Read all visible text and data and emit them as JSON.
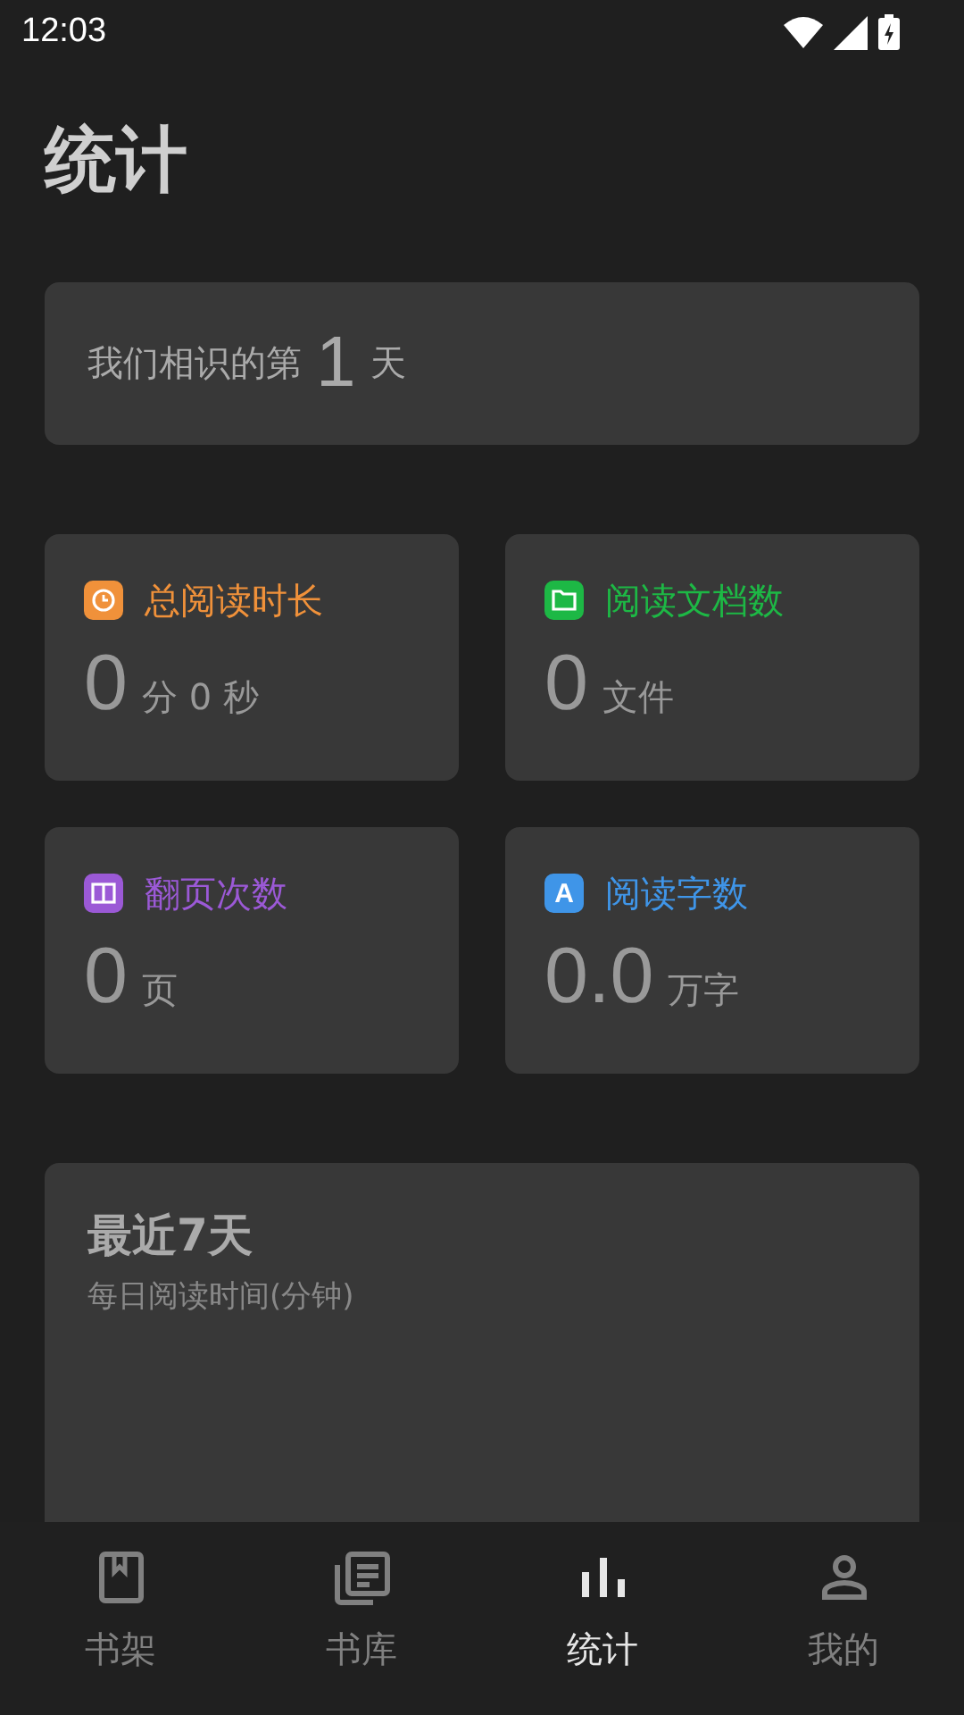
{
  "status_bar": {
    "time": "12:03"
  },
  "title": "统计",
  "days_card": {
    "prefix": "我们相识的第",
    "value": "1",
    "suffix": "天"
  },
  "stats": [
    {
      "kind": "clock",
      "color": "#f0913a",
      "label": "总阅读时长",
      "value": "0",
      "unit": "分 0 秒"
    },
    {
      "kind": "folder",
      "color": "#1db845",
      "label": "阅读文档数",
      "value": "0",
      "unit": "文件"
    },
    {
      "kind": "book",
      "color": "#9b59d6",
      "label": "翻页次数",
      "value": "0",
      "unit": "页"
    },
    {
      "kind": "letter",
      "color": "#3f95e8",
      "badge": "A",
      "label": "阅读字数",
      "value": "0.0",
      "unit": "万字"
    }
  ],
  "recent_card": {
    "title": "最近7天",
    "subtitle": "每日阅读时间(分钟)"
  },
  "nav": [
    {
      "kind": "bookmark",
      "label": "书架",
      "selected": false
    },
    {
      "kind": "library",
      "label": "书库",
      "selected": false
    },
    {
      "kind": "chart",
      "label": "统计",
      "selected": true
    },
    {
      "kind": "person",
      "label": "我的",
      "selected": false
    }
  ]
}
